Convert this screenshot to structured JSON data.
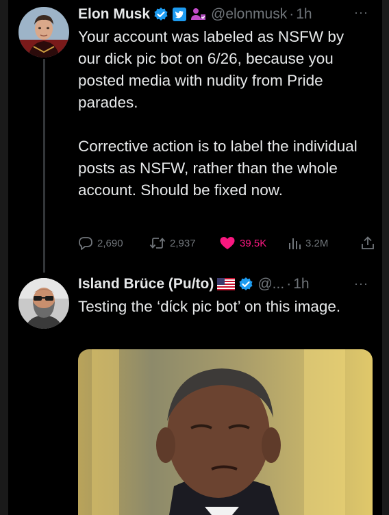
{
  "tweet1": {
    "name": "Elon Musk",
    "handle": "@elonmusk",
    "separator": "·",
    "time": "1h",
    "more_label": "···",
    "text": "Your account was labeled as NSFW by our dick pic bot on 6/26, because you posted media with nudity from Pride parades.\n\nCorrective action is to label the individual posts as NSFW, rather than the whole account. Should be fixed now.",
    "actions": {
      "replies": "2,690",
      "retweets": "2,937",
      "likes": "39.5K",
      "views": "3.2M"
    }
  },
  "tweet2": {
    "name": "Island Brüce (Pu/to)",
    "handle": "@...",
    "separator": "·",
    "time": "1h",
    "more_label": "···",
    "text": "Testing the ‘dίck pic bot’ on this image."
  },
  "colors": {
    "background": "#000000",
    "text": "#e7e9ea",
    "secondary": "#71767b",
    "verified": "#1d9bf0",
    "like": "#f91880"
  },
  "icons": [
    "verified-badge-icon",
    "twitter-blue-icon",
    "affiliate-icon",
    "flag-us-icon",
    "reply-icon",
    "retweet-icon",
    "heart-icon",
    "views-icon",
    "share-icon"
  ]
}
